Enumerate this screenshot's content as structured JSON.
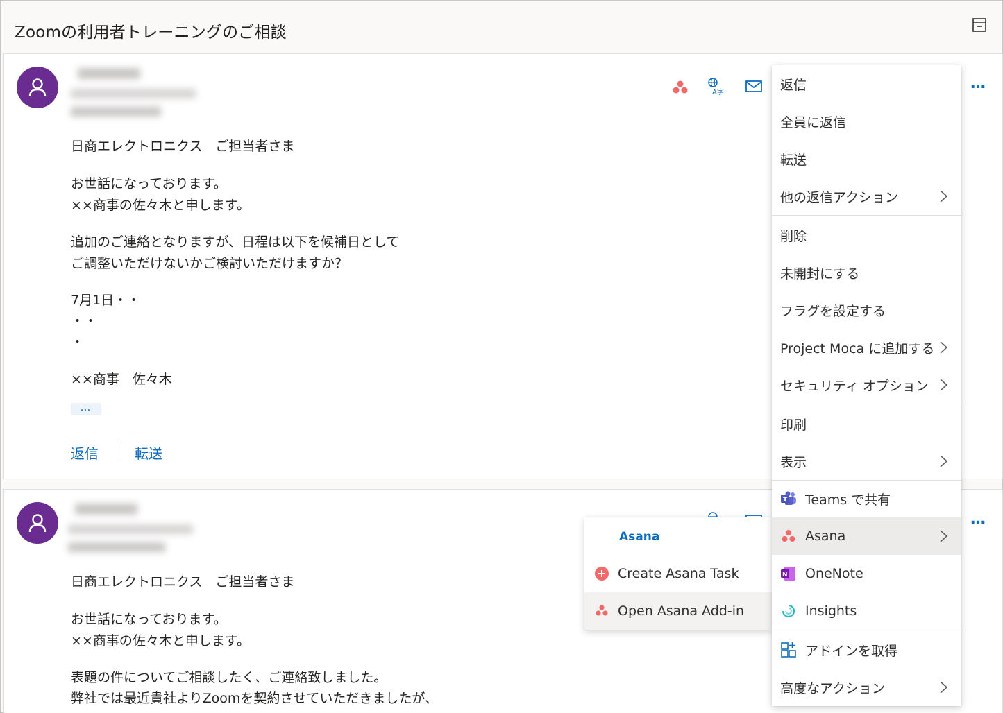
{
  "window": {
    "title": "Zoomの利用者トレーニングのご相談"
  },
  "message1": {
    "body_lines": [
      "日商エレクトロニクス　ご担当者さま",
      "お世話になっております。",
      "××商事の佐々木と申します。",
      "追加のご連絡となりますが、日程は以下を候補日として",
      "ご調整いただけないかご検討いただけますか？",
      "7月1日・・",
      "・・",
      "・",
      "××商事　佐々木"
    ],
    "expand_label": "…",
    "reply_label": "返信",
    "forward_label": "転送",
    "more_label": "…"
  },
  "message2": {
    "body_lines": [
      "日商エレクトロニクス　ご担当者さま",
      "お世話になっております。",
      "××商事の佐々木と申します。",
      "表題の件についてご相談したく、ご連絡致しました。",
      "弊社では最近貴社よりZoomを契約させていただきましたが、"
    ],
    "more_label": "…"
  },
  "context_menu": {
    "items": [
      {
        "label": "返信"
      },
      {
        "label": "全員に返信"
      },
      {
        "label": "転送"
      },
      {
        "label": "他の返信アクション"
      },
      {
        "label": "削除"
      },
      {
        "label": "未開封にする"
      },
      {
        "label": "フラグを設定する"
      },
      {
        "label": "Project Moca に追加する"
      },
      {
        "label": "セキュリティ オプション"
      },
      {
        "label": "印刷"
      },
      {
        "label": "表示"
      },
      {
        "label": "Teams で共有"
      },
      {
        "label": "Asana"
      },
      {
        "label": "OneNote"
      },
      {
        "label": "Insights"
      },
      {
        "label": "アドインを取得"
      },
      {
        "label": "高度なアクション"
      }
    ]
  },
  "asana_submenu": {
    "header": "Asana",
    "items": [
      {
        "label": "Create Asana Task"
      },
      {
        "label": "Open Asana Add-in"
      }
    ]
  },
  "colors": {
    "accent": "#0f6cbd",
    "avatar": "#6b2c91",
    "asana": "#f06a6a",
    "teams": "#5b5fc7",
    "onenote": "#7719aa",
    "insights": "#2db7c2"
  }
}
